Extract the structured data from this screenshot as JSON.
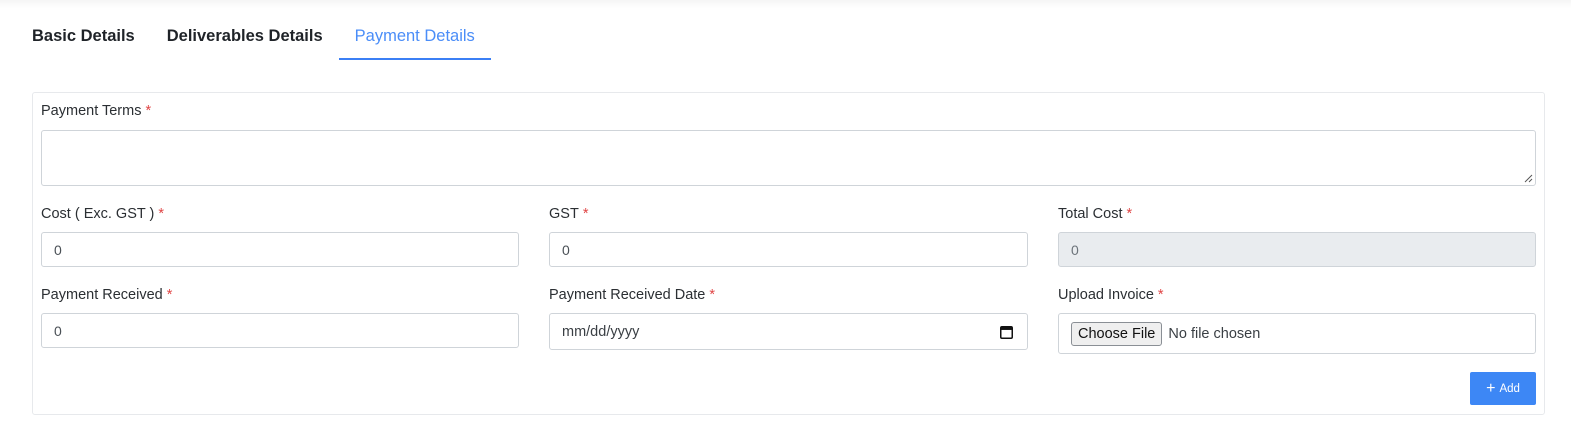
{
  "tabs": [
    {
      "label": "Basic Details",
      "active": false
    },
    {
      "label": "Deliverables Details",
      "active": false
    },
    {
      "label": "Payment Details",
      "active": true
    }
  ],
  "form": {
    "required_mark": "*",
    "payment_terms": {
      "label": "Payment Terms",
      "value": ""
    },
    "cost": {
      "label": "Cost ( Exc. GST )",
      "value": "0"
    },
    "gst": {
      "label": "GST",
      "value": "0"
    },
    "total_cost": {
      "label": "Total Cost",
      "value": "0",
      "disabled": true
    },
    "payment_received": {
      "label": "Payment Received",
      "value": "0"
    },
    "payment_received_date": {
      "label": "Payment Received Date",
      "placeholder": "mm/dd/yyyy",
      "icon": "calendar-icon"
    },
    "upload_invoice": {
      "label": "Upload Invoice",
      "button_label": "Choose File",
      "status": "No file chosen"
    }
  },
  "actions": {
    "add": {
      "label": "Add",
      "icon": "plus-icon"
    }
  },
  "colors": {
    "accent": "#3d87f5",
    "required": "#e04545",
    "disabled_bg": "#e9ecef"
  }
}
